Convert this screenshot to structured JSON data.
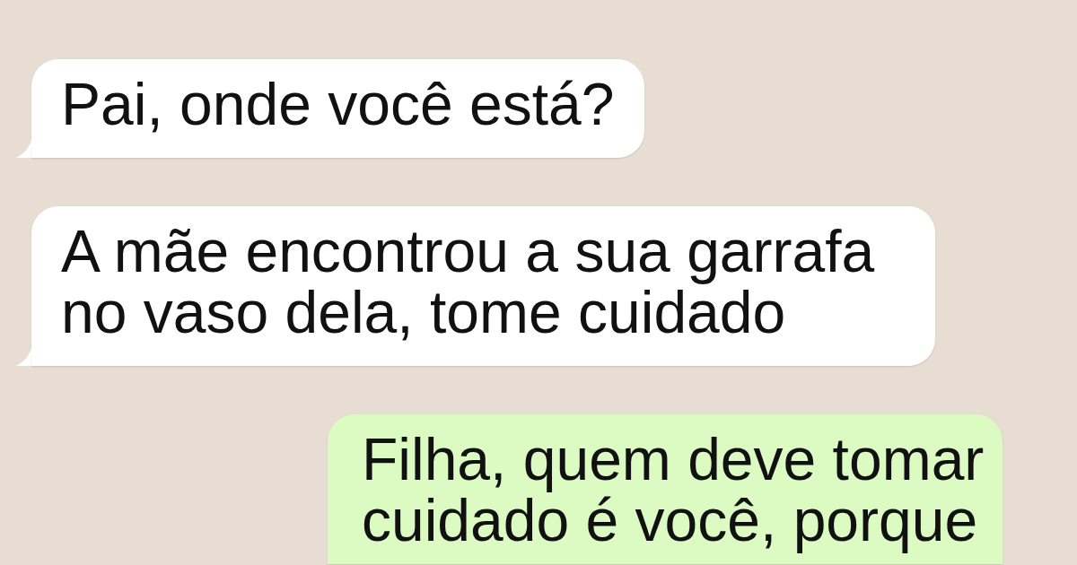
{
  "chat": {
    "messages": [
      {
        "kind": "incoming",
        "text": "Pai, onde você está?"
      },
      {
        "kind": "incoming",
        "text": "A mãe encontrou a sua garrafa no vaso dela, tome cuidado"
      },
      {
        "kind": "outgoing",
        "text": "Filha, quem deve tomar cuidado é você, porque"
      }
    ]
  }
}
